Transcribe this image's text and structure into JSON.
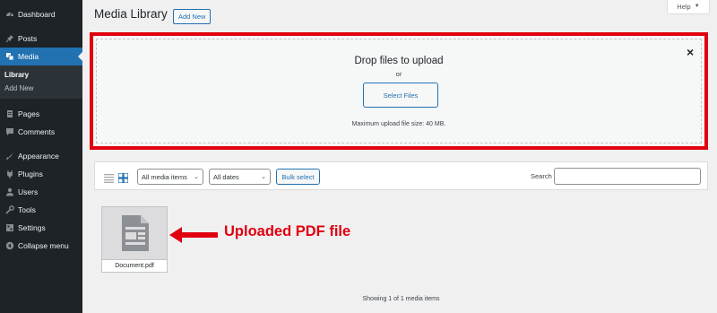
{
  "sidebar": {
    "items": [
      {
        "label": "Dashboard",
        "icon": "dashboard-icon"
      },
      {
        "label": "Posts",
        "icon": "pin-icon"
      },
      {
        "label": "Media",
        "icon": "media-icon"
      },
      {
        "label": "Pages",
        "icon": "pages-icon"
      },
      {
        "label": "Comments",
        "icon": "comments-icon"
      },
      {
        "label": "Appearance",
        "icon": "brush-icon"
      },
      {
        "label": "Plugins",
        "icon": "plugins-icon"
      },
      {
        "label": "Users",
        "icon": "users-icon"
      },
      {
        "label": "Tools",
        "icon": "wrench-icon"
      },
      {
        "label": "Settings",
        "icon": "settings-icon"
      },
      {
        "label": "Collapse menu",
        "icon": "collapse-icon"
      }
    ],
    "submenu": [
      "Library",
      "Add New"
    ],
    "active": "Media"
  },
  "header": {
    "title": "Media Library",
    "add_new": "Add New",
    "help": "Help"
  },
  "upload": {
    "title": "Drop files to upload",
    "or": "or",
    "select_files": "Select Files",
    "max_size": "Maximum upload file size: 40 MB.",
    "close": "×"
  },
  "toolbar": {
    "filter_type": "All media items",
    "filter_date": "All dates",
    "bulk_select": "Bulk select",
    "search_label": "Search",
    "search_value": ""
  },
  "attachments": [
    {
      "name": "Document.pdf",
      "icon": "document-icon"
    }
  ],
  "annotation": {
    "text": "Uploaded PDF file",
    "color": "#e0000f"
  },
  "status": {
    "showing": "Showing 1 of 1 media items"
  },
  "colors": {
    "sidebar_bg": "#1d2327",
    "accent": "#2271b1",
    "highlight_red": "#e0000f"
  }
}
